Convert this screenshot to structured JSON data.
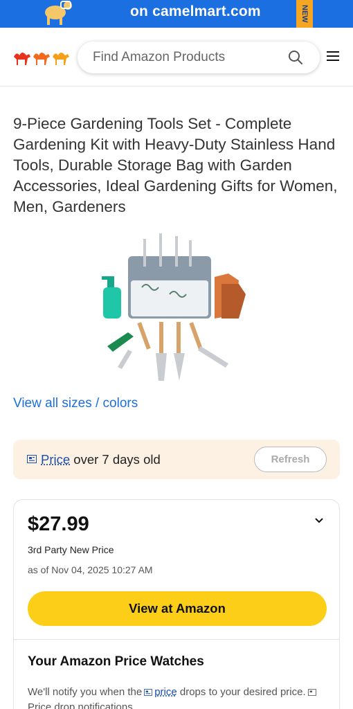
{
  "banner": {
    "text": "on camelmart.com",
    "badge": "NEW"
  },
  "header": {
    "search_placeholder": "Find Amazon Products"
  },
  "product": {
    "title": "9-Piece Gardening Tools Set - Complete Gardening Kit with Heavy-Duty Stainless Hand Tools, Durable Storage Bag with Garden Accessories, Ideal Gardening Gifts for Women, Men, Gardeners",
    "sizes_link": "View all sizes / colors"
  },
  "notice": {
    "link": "Price",
    "text": " over 7 days old",
    "refresh_label": "Refresh"
  },
  "price_card": {
    "price": "$27.99",
    "price_type": "3rd Party New Price",
    "as_of": "as of Nov 04, 2025 10:27 AM",
    "button_label": "View at Amazon"
  },
  "watches": {
    "title": "Your Amazon Price Watches",
    "desc_before": "We'll notify you when the",
    "desc_link": "price",
    "desc_after": "drops to your desired price.",
    "desc_extra": "Price drop notifications"
  },
  "colors": {
    "brand_blue": "#1c6fe0",
    "link_blue": "#1c6fd8",
    "amazon_yellow": "#fcce17",
    "notice_bg": "#fdf1e3"
  }
}
